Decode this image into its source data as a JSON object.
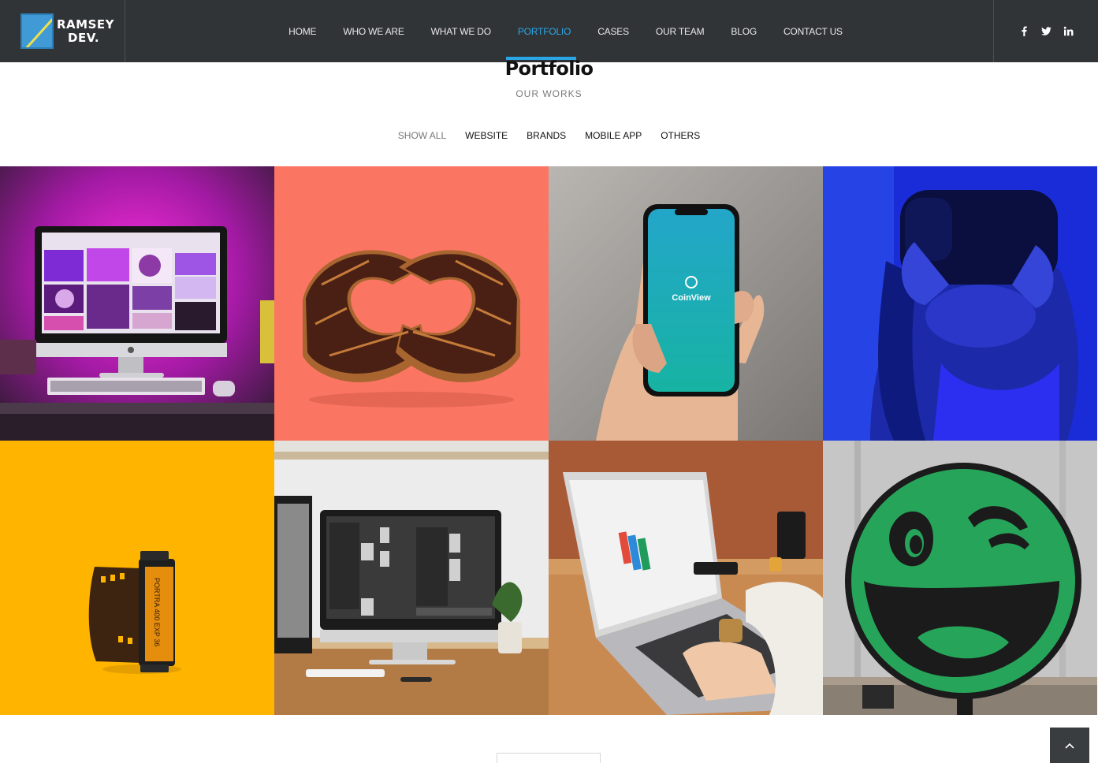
{
  "brand": {
    "name_line1": "RAMSEY",
    "name_line2": "DEV."
  },
  "nav": {
    "items": [
      {
        "label": "HOME",
        "active": false
      },
      {
        "label": "WHO WE ARE",
        "active": false
      },
      {
        "label": "WHAT WE DO",
        "active": false
      },
      {
        "label": "PORTFOLIO",
        "active": true
      },
      {
        "label": "CASES",
        "active": false
      },
      {
        "label": "OUR TEAM",
        "active": false
      },
      {
        "label": "BLOG",
        "active": false
      },
      {
        "label": "CONTACT US",
        "active": false
      }
    ]
  },
  "social": {
    "icons": [
      "facebook-icon",
      "twitter-icon",
      "linkedin-icon"
    ]
  },
  "portfolio": {
    "title": "Portfolio",
    "subtitle": "OUR WORKS",
    "filters": [
      {
        "label": "SHOW ALL",
        "active": true
      },
      {
        "label": "WEBSITE",
        "active": false
      },
      {
        "label": "BRANDS",
        "active": false
      },
      {
        "label": "MOBILE APP",
        "active": false
      },
      {
        "label": "OTHERS",
        "active": false
      }
    ],
    "tiles": [
      {
        "subject": "desktop-monitor-pink-light"
      },
      {
        "subject": "chocolate-donuts-coral"
      },
      {
        "subject": "phone-coinview-app",
        "app_name": "CoinView"
      },
      {
        "subject": "child-vr-headset-blue"
      },
      {
        "subject": "film-roll-yellow",
        "film_label": "PORTRA 400 EXP 36"
      },
      {
        "subject": "imac-desk-workspace"
      },
      {
        "subject": "laptop-typing-desk"
      },
      {
        "subject": "green-smiley-sign"
      }
    ]
  },
  "colors": {
    "header_bg": "#313437",
    "accent": "#2aa6e6",
    "title_text": "#111111"
  }
}
